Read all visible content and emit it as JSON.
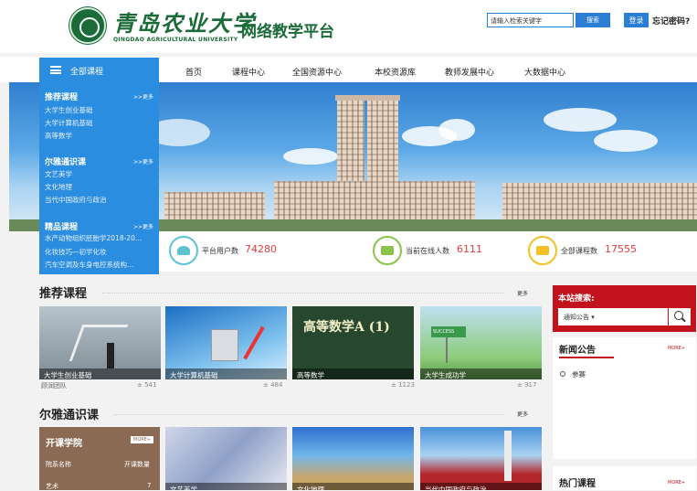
{
  "header": {
    "logo_cn": "青岛农业大学",
    "logo_en": "QINGDAO AGRICULTURAL UNIVERSITY",
    "platform_title": "网络教学平台",
    "search_placeholder": "请输入检索关键字",
    "search_button": "搜索",
    "login_button": "登录",
    "forgot_password": "忘记密码?"
  },
  "nav": {
    "all_courses": "全部课程",
    "items": [
      "首页",
      "课程中心",
      "全国资源中心",
      "本校资源库",
      "教师发展中心",
      "大数据中心"
    ]
  },
  "menu": {
    "more": ">>更多",
    "cat1": {
      "title": "推荐课程",
      "subs": [
        "大学生创业基础",
        "大学计算机基础",
        "高等数学"
      ]
    },
    "cat2": {
      "title": "尔雅通识课",
      "subs": [
        "文艺美学",
        "文化地理",
        "当代中国政府与政治"
      ]
    },
    "cat3": {
      "title": "精品课程",
      "subs": [
        "水产动物组织胚胎学2018-20...",
        "化妆技巧—初学化妆",
        "汽车空调及车身电控系统构..."
      ]
    }
  },
  "stats": [
    {
      "label": "平台用户数",
      "value": "74280",
      "icon": "users-icon"
    },
    {
      "label": "当前在线人数",
      "value": "6111",
      "icon": "online-user-icon"
    },
    {
      "label": "全部课程数",
      "value": "17555",
      "icon": "course-icon"
    }
  ],
  "recommended": {
    "title": "推荐课程",
    "more": "更多",
    "cards": [
      {
        "title": "大学生创业基础",
        "author": "顾润团队",
        "count": "541"
      },
      {
        "title": "大学计算机基础",
        "author": "",
        "count": "484"
      },
      {
        "title": "高等数学",
        "author": "",
        "count": "1123",
        "board_text": "高等数学A (1)"
      },
      {
        "title": "大学生成功学",
        "author": "",
        "count": "317",
        "sign_text": "SUCCESS"
      }
    ]
  },
  "erya": {
    "title": "尔雅通识课",
    "more": "更多",
    "college_title": "开课学院",
    "college_more": "MORE+",
    "college_cols": [
      "院系名称",
      "开课数量"
    ],
    "college_row": [
      "艺术",
      "7"
    ],
    "card_caps": [
      "文艺美学",
      "文化地理",
      "当代中国政府与政治"
    ]
  },
  "sidebar": {
    "search_title": "本站搜索:",
    "search_select": "通知公告",
    "news_title": "新闻公告",
    "news_more": "MORE+",
    "news_item": "参赛",
    "hot_title": "热门课程",
    "hot_more": "MORE+"
  },
  "colors": {
    "accent": "#2b8ddf",
    "brand": "#1a6b38",
    "highlight": "#c3141d",
    "stat_value": "#e23b3b"
  }
}
